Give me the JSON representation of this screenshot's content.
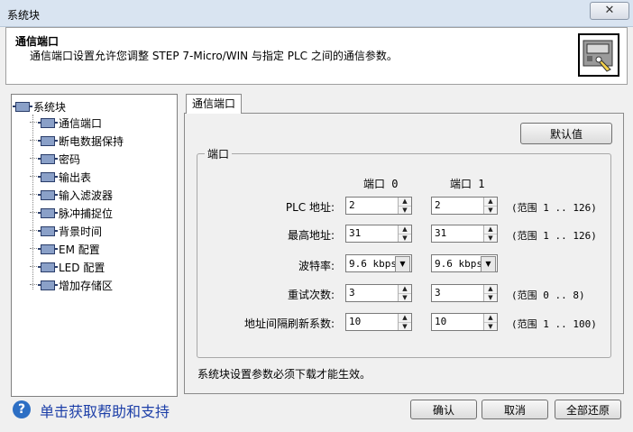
{
  "window": {
    "title": "系统块"
  },
  "header": {
    "title": "通信端口",
    "description": "通信端口设置允许您调整 STEP 7-Micro/WIN 与指定 PLC 之间的通信参数。"
  },
  "tree": {
    "root": "系统块",
    "items": [
      "通信端口",
      "断电数据保持",
      "密码",
      "输出表",
      "输入滤波器",
      "脉冲捕捉位",
      "背景时间",
      "EM 配置",
      "LED 配置",
      "增加存储区"
    ]
  },
  "tab": {
    "label": "通信端口"
  },
  "panel": {
    "default_button": "默认值",
    "group_title": "端口",
    "port0_header": "端口 0",
    "port1_header": "端口 1",
    "rows": [
      {
        "label": "PLC 地址:",
        "port0": "2",
        "port1": "2",
        "range": "(范围 1 .. 126)"
      },
      {
        "label": "最高地址:",
        "port0": "31",
        "port1": "31",
        "range": "(范围 1 .. 126)"
      },
      {
        "label": "波特率:",
        "port0": "9.6 kbps",
        "port1": "9.6 kbps",
        "range": ""
      },
      {
        "label": "重试次数:",
        "port0": "3",
        "port1": "3",
        "range": "(范围 0 .. 8)"
      },
      {
        "label": "地址间隔刷新系数:",
        "port0": "10",
        "port1": "10",
        "range": "(范围 1 .. 100)"
      }
    ],
    "note": "系统块设置参数必须下载才能生效。"
  },
  "footer": {
    "help_text": "单击获取帮助和支持",
    "ok": "确认",
    "cancel": "取消",
    "reset_all": "全部还原"
  },
  "icons": {
    "close": "close-icon",
    "help": "help-icon",
    "chip": "module-icon",
    "dropdown": "chevron-down-icon"
  }
}
